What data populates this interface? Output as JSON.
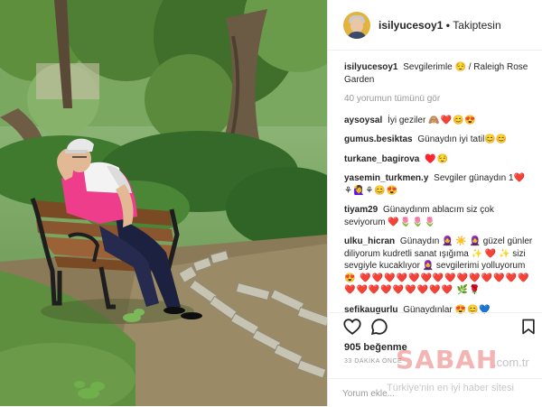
{
  "post": {
    "username": "isilyucesoy1",
    "follow_status": "Takiptesin",
    "caption": {
      "user": "isilyucesoy1",
      "text": "Sevgilerimle 😌 / Raleigh Rose Garden"
    },
    "view_all_comments": "40 yorumun tümünü gör",
    "comments": [
      {
        "user": "aysoysal",
        "text": "İyi geziler",
        "emoji": "🙈❤️😊😍"
      },
      {
        "user": "gumus.besiktas",
        "text": "Günaydın iyi tatil😊😊",
        "emoji": ""
      },
      {
        "user": "turkane_bagirova",
        "text": "",
        "emoji": "♥️😌"
      },
      {
        "user": "yasemin_turkmen.y",
        "text": "Sevgiler günaydın 1❤️",
        "emoji": "⚘🙋‍♀️⚘😊😍"
      },
      {
        "user": "tiyam29",
        "text": "Günaydınm ablacım siz çok seviyorum",
        "emoji": "❤️🌷🌷🌷"
      },
      {
        "user": "ulku_hicran",
        "text": "Günaydın 🧕 ☀️ 🧕 güzel günler diliyorum kudretli sanat ışığıma ✨ ❤️ ✨ sizi sevgiyle kucaklıyor 🧕 sevgilerimi yolluyorum",
        "emoji": "😍 ❤️❤️❤️❤️❤️❤️❤️❤️❤️❤️❤️❤️❤️❤️❤️❤️❤️❤️❤️❤️❤️❤️❤️ 🌿🌹"
      },
      {
        "user": "sefikaugurlu",
        "text": "Günaydınlar",
        "emoji": "😍😊💙"
      }
    ],
    "likes": "905 beğenme",
    "time_ago": "33 DAKİKA ÖNCE",
    "comment_placeholder": "Yorum ekle...",
    "icons": {
      "like": "heart-icon",
      "comment": "comment-icon",
      "save": "bookmark-icon"
    }
  },
  "watermark": {
    "logo": "SABAH",
    "tld": ".com.tr",
    "slogan": "Türkiye'nin en iyi haber sitesi"
  },
  "colors": {
    "text": "#262626",
    "muted": "#999999",
    "border": "#efefef",
    "shirt": "#ee3d8a"
  }
}
